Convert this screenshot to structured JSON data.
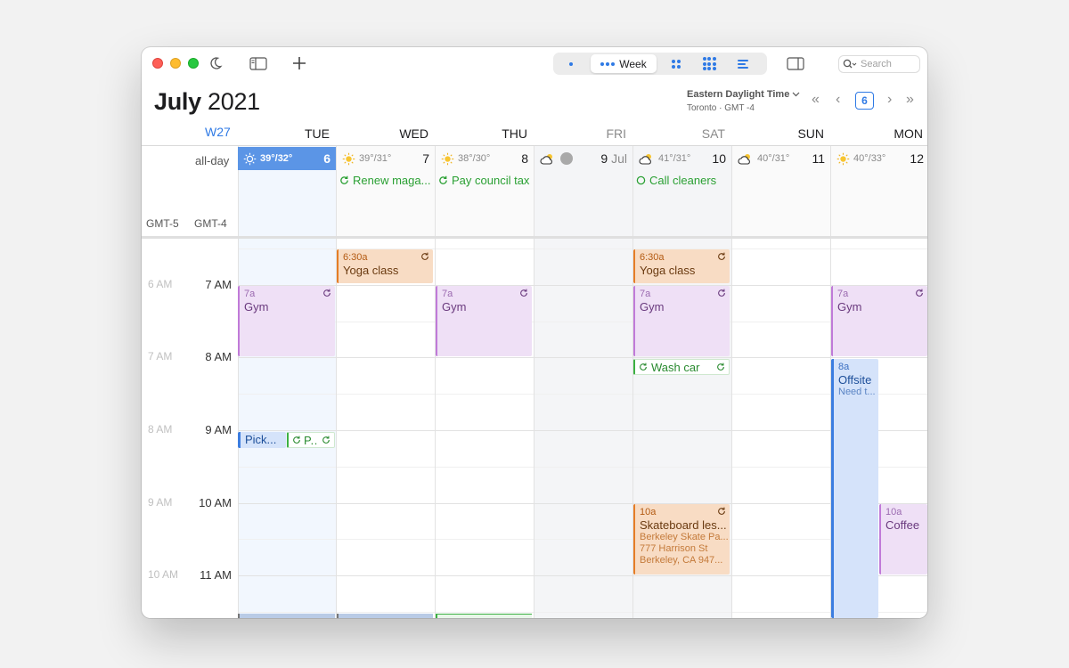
{
  "toolbar": {
    "view_week_label": "Week",
    "search_placeholder": "Search"
  },
  "header": {
    "month": "July",
    "year": "2021",
    "timezone_name": "Eastern Daylight Time",
    "timezone_sub": "Toronto · GMT -4",
    "today_button": "6",
    "nav_first": "«",
    "nav_prev": "‹",
    "nav_next": "›",
    "nav_last": "»"
  },
  "week_label": "W27",
  "days": [
    {
      "name": "TUE",
      "num": "6",
      "weather": "39°/32°",
      "icon": "sun-icon",
      "today": true
    },
    {
      "name": "WED",
      "num": "7",
      "weather": "39°/31°",
      "icon": "sun-icon"
    },
    {
      "name": "THU",
      "num": "8",
      "weather": "38°/30°",
      "icon": "sun-icon"
    },
    {
      "name": "FRI",
      "num": "9",
      "month_suffix": "Jul",
      "weather": "",
      "icon": "cloud-sun-icon",
      "muted": true
    },
    {
      "name": "SAT",
      "num": "10",
      "weather": "41°/31°",
      "icon": "cloud-sun-icon",
      "muted": true
    },
    {
      "name": "SUN",
      "num": "11",
      "weather": "40°/31°",
      "icon": "cloud-sun-icon"
    },
    {
      "name": "MON",
      "num": "12",
      "weather": "40°/33°",
      "icon": "sun-icon"
    }
  ],
  "allday": {
    "label": "all-day",
    "gmt_secondary": "GMT-5",
    "gmt_primary": "GMT-4",
    "events": [
      {
        "day": 1,
        "title": "Renew maga..."
      },
      {
        "day": 2,
        "title": "Pay council tax"
      },
      {
        "day": 4,
        "title": "Call cleaners"
      }
    ]
  },
  "hours": [
    {
      "alt": "6 AM",
      "main": "7 AM"
    },
    {
      "alt": "7 AM",
      "main": "8 AM"
    },
    {
      "alt": "8 AM",
      "main": "9 AM"
    },
    {
      "alt": "9 AM",
      "main": "10 AM"
    },
    {
      "alt": "10 AM",
      "main": "11 AM"
    }
  ],
  "events": {
    "yoga_wed": {
      "time": "6:30a",
      "title": "Yoga class"
    },
    "yoga_sat": {
      "time": "6:30a",
      "title": "Yoga class"
    },
    "gym_tue": {
      "time": "7a",
      "title": "Gym"
    },
    "gym_thu": {
      "time": "7a",
      "title": "Gym"
    },
    "gym_sat": {
      "time": "7a",
      "title": "Gym"
    },
    "gym_mon": {
      "time": "7a",
      "title": "Gym"
    },
    "washcar": {
      "title": "Wash car"
    },
    "offsite": {
      "time": "8a",
      "title": "Offsite",
      "note": "Need t..."
    },
    "pick": {
      "title": "Pick..."
    },
    "p": {
      "title": "P..."
    },
    "skate": {
      "time": "10a",
      "title": "Skateboard les...",
      "note1": "Berkeley Skate Pa...",
      "note2": "777 Harrison St",
      "note3": "Berkeley, CA  947..."
    },
    "coffee": {
      "time": "10a",
      "title": "Coffee"
    }
  },
  "colors": {
    "accent": "#2f7ae5",
    "orange": "#e57d26",
    "purple": "#c07ad8",
    "green": "#3cb043",
    "blue": "#3b7de0"
  }
}
